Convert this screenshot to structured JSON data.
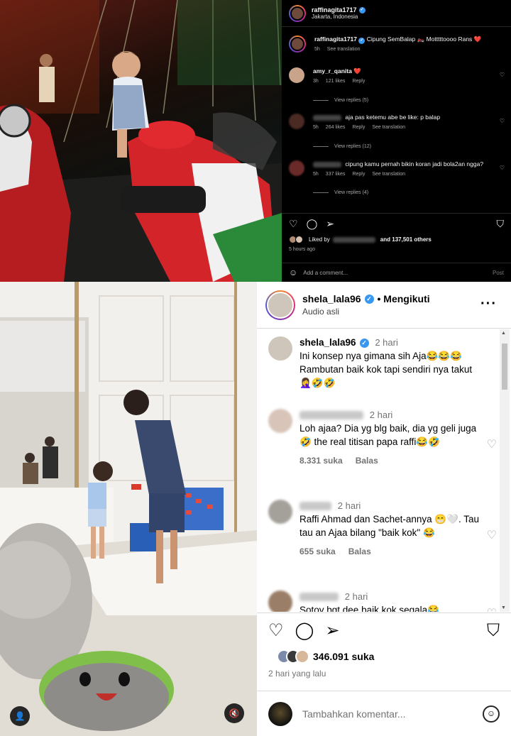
{
  "top_post": {
    "username": "raffinagita1717",
    "location": "Jakarta, Indonesia",
    "comments": [
      {
        "user": "raffinagita1717",
        "text": "Cipung SemBalap 🏍️ Motttttoooo Rans ❤️",
        "time": "5h",
        "likes": "",
        "reply": "",
        "translate": "See translation"
      },
      {
        "user": "amy_r_qanita",
        "text": "❤️",
        "time": "3h",
        "likes": "121 likes",
        "reply": "Reply",
        "translate": ""
      },
      {
        "user": "",
        "text": "aja pas ketemu abe be like: p balap",
        "time": "5h",
        "likes": "264 likes",
        "reply": "Reply",
        "translate": "See translation"
      },
      {
        "user": "",
        "text": "cipung kamu pernah bikin koran jadi bola2an ngga?",
        "time": "5h",
        "likes": "337 likes",
        "reply": "Reply",
        "translate": "See translation"
      }
    ],
    "view_replies": [
      "View replies (5)",
      "View replies (12)",
      "View replies (4)"
    ],
    "liked_by_prefix": "Liked by",
    "liked_by_suffix": "and 137,501 others",
    "time_ago": "5 hours ago",
    "add_comment_placeholder": "Add a comment...",
    "post_button": "Post"
  },
  "bottom_post": {
    "username": "shela_lala96",
    "following_label": "• Mengikuti",
    "audio": "Audio asli",
    "comments": [
      {
        "user": "shela_lala96",
        "time": "2 hari",
        "text": "Ini konsep nya gimana sih Aja😂😂😂 Rambutan baik kok tapi sendiri nya takut🤦‍♀️🤣🤣",
        "likes": "",
        "reply": ""
      },
      {
        "user": "",
        "time": "2 hari",
        "text": "Loh ajaa? Dia yg blg baik, dia yg geli juga🤣 the real titisan papa raffi😂🤣",
        "likes": "8.331 suka",
        "reply": "Balas"
      },
      {
        "user": "",
        "time": "2 hari",
        "text": "Raffi Ahmad dan Sachet-annya 😁🤍. Tau tau an Ajaa bilang \"baik kok\" 😂",
        "likes": "655 suka",
        "reply": "Balas"
      },
      {
        "user": "",
        "time": "2 hari",
        "text": "Sotoy bgt dee baik kok segala😂",
        "likes": "",
        "reply": ""
      }
    ],
    "likes_count": "346.091 suka",
    "time_ago": "2 hari yang lalu",
    "add_comment_placeholder": "Tambahkan komentar..."
  }
}
